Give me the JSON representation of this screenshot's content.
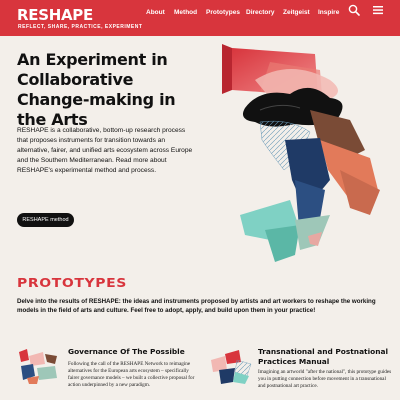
{
  "header": {
    "logo": "RESHAPE",
    "tagline": "REFLECT, SHARE, PRACTICE, EXPERIMENT",
    "nav": [
      "About",
      "Method",
      "Prototypes",
      "Directory",
      "Zeitgeist",
      "Inspire"
    ],
    "icons": {
      "search": "search-icon",
      "menu": "hamburger-menu-icon"
    },
    "bg_color": "#d8353d"
  },
  "hero": {
    "title": "An Experiment in Collaborative Change-making in the Arts",
    "body": "RESHAPE is a collaborative, bottom-up research process that proposes instruments for transition towards an alternative, fairer, and unified arts ecosystem across Europe and the Southern Mediterranean. Read more about RESHAPE's experimental method and process.",
    "button": "RESHAPE method"
  },
  "prototypes": {
    "title": "PROTOTYPES",
    "intro": "Delve into the results of RESHAPE: the ideas and instruments proposed by artists and art workers to reshape the working models in the field of arts and culture. Feel free to adopt, apply, and build upon them in your practice!",
    "cards": [
      {
        "title": "Governance Of The Possible",
        "text": "Following the call of the RESHAPE Network to reimagine alternatives for the European arts ecosystem – specifically fairer governance models – we built a collective proposal for action underpinned by a new paradigm."
      },
      {
        "title": "Transnational and Postnational Practices Manual",
        "text": "Imagining an artworld \"after the national\", this prototype guides you in putting connection before movement in a transnational and postnational art practice."
      }
    ]
  },
  "accent_color": "#d8353d"
}
